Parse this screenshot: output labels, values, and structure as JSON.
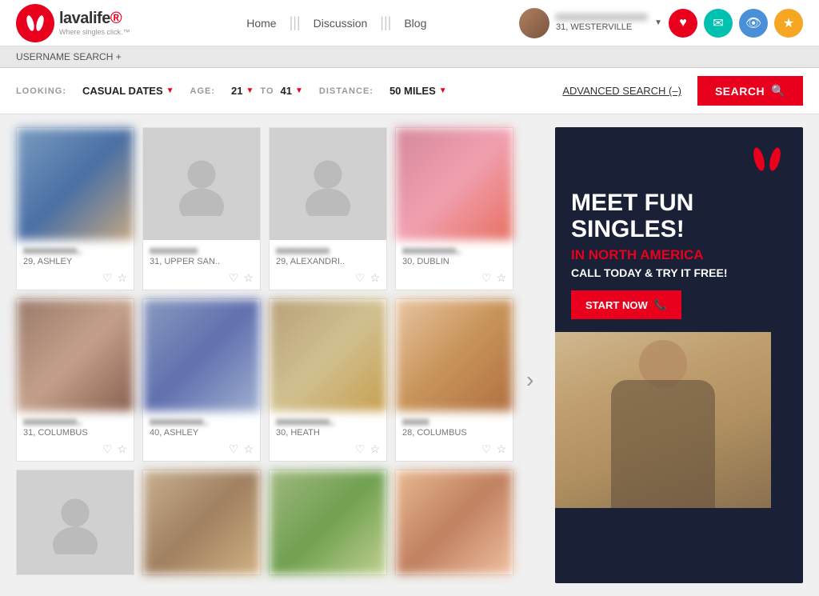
{
  "header": {
    "logo_text": "lavalife",
    "logo_reg": "®",
    "tagline": "Where singles click.™",
    "nav": [
      {
        "label": "Home",
        "id": "home"
      },
      {
        "label": "Discussion",
        "id": "discussion"
      },
      {
        "label": "Blog",
        "id": "blog"
      }
    ],
    "user": {
      "name": "XXXXXXXXXXXXXXX",
      "location": "31, WESTERVILLE"
    },
    "icons": {
      "heart": "♥",
      "mail": "✉",
      "eye": "👁",
      "star": "★"
    }
  },
  "username_search": {
    "label": "USERNAME SEARCH +"
  },
  "search_filters": {
    "looking_label": "LOOKING:",
    "looking_value": "CASUAL DATES",
    "age_label": "AGE:",
    "age_from": "21",
    "age_to_label": "TO",
    "age_to": "41",
    "distance_label": "DISTANCE:",
    "distance_value": "50 MILES",
    "advanced_label": "ADVANCED SEARCH (–)",
    "search_btn": "SEARCH"
  },
  "profiles": [
    {
      "row": 1,
      "cards": [
        {
          "username": "xxxxxxxxxx..",
          "age": "29",
          "location": "ASHLEY",
          "has_photo": true,
          "photo_type": "1"
        },
        {
          "username": "xxxxxxxxx",
          "age": "31",
          "location": "UPPER SAN..",
          "has_photo": false
        },
        {
          "username": "xxxxxxxxxx",
          "age": "29",
          "location": "ALEXANDRI..",
          "has_photo": false
        },
        {
          "username": "xxxxxxxxxx..",
          "age": "30",
          "location": "DUBLIN",
          "has_photo": true,
          "photo_type": "4"
        }
      ]
    },
    {
      "row": 2,
      "cards": [
        {
          "username": "xxxxxxxxxx..",
          "age": "31",
          "location": "COLUMBUS",
          "has_photo": true,
          "photo_type": "5"
        },
        {
          "username": "xxxxxxxxxx..",
          "age": "40",
          "location": "ASHLEY",
          "has_photo": true,
          "photo_type": "6"
        },
        {
          "username": "xxxxxxxxxx..",
          "age": "30",
          "location": "HEATH",
          "has_photo": true,
          "photo_type": "7"
        },
        {
          "username": "xxxxx",
          "age": "28",
          "location": "COLUMBUS",
          "has_photo": true,
          "photo_type": "3"
        }
      ]
    },
    {
      "row": 3,
      "cards": [
        {
          "username": "",
          "age": "",
          "location": "",
          "has_photo": false
        },
        {
          "username": "",
          "age": "",
          "location": "",
          "has_photo": true,
          "photo_type": "2"
        },
        {
          "username": "",
          "age": "",
          "location": "",
          "has_photo": true,
          "photo_type": "1"
        },
        {
          "username": "",
          "age": "",
          "location": "",
          "has_photo": true,
          "photo_type": "4"
        }
      ]
    }
  ],
  "ad": {
    "logo": "ll",
    "headline": "MEET FUN SINGLES!",
    "subheadline": "IN NORTH AMERICA",
    "cta_text": "CALL TODAY & TRY IT FREE!",
    "btn_label": "START NOW",
    "btn_icon": "📞"
  }
}
